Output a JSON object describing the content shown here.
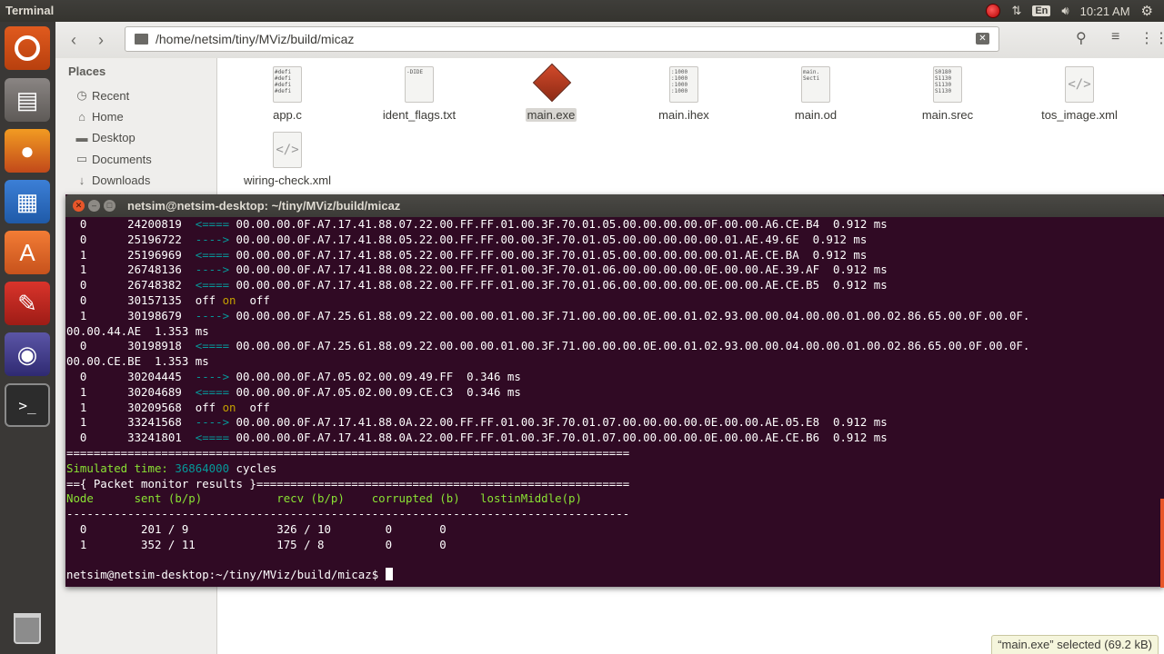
{
  "top_panel": {
    "app_title": "Terminal",
    "keyboard_layout": "En",
    "clock": "10:21 AM"
  },
  "toolbar": {
    "back": "‹",
    "forward": "›",
    "path": "/home/netsim/tiny/MViz/build/micaz"
  },
  "sidebar": {
    "heading": "Places",
    "items": [
      {
        "label": "Recent",
        "icon": "clock-icon"
      },
      {
        "label": "Home",
        "icon": "home-icon"
      },
      {
        "label": "Desktop",
        "icon": "desktop-folder-icon"
      },
      {
        "label": "Documents",
        "icon": "documents-icon"
      },
      {
        "label": "Downloads",
        "icon": "downloads-icon"
      }
    ]
  },
  "files": [
    {
      "name": "app.c",
      "preview": "#defi\n#defi\n#defi\n#defi"
    },
    {
      "name": "ident_flags.txt",
      "preview": "-DIDE"
    },
    {
      "name": "main.exe",
      "preview": ""
    },
    {
      "name": "main.ihex",
      "preview": ":1000\n:1000\n:1000\n:1000"
    },
    {
      "name": "main.od",
      "preview": "main.\n\nSecti"
    },
    {
      "name": "main.srec",
      "preview": "S0180\nS1130\nS1130\nS1130"
    },
    {
      "name": "tos_image.xml",
      "preview": "</>"
    },
    {
      "name": "wiring-check.xml",
      "preview": "</>"
    }
  ],
  "terminal": {
    "title": "netsim@netsim-desktop: ~/tiny/MViz/build/micaz",
    "rows": [
      {
        "node": "0",
        "time": "24200819",
        "dir": "<====",
        "packet": "00.00.00.0F.A7.17.41.88.07.22.00.FF.FF.01.00.3F.70.01.05.00.00.00.00.0F.00.00.A6.CE.B4",
        "dur": "0.912 ms"
      },
      {
        "node": "0",
        "time": "25196722",
        "dir": "---->",
        "packet": "00.00.00.0F.A7.17.41.88.05.22.00.FF.FF.00.00.3F.70.01.05.00.00.00.00.00.01.AE.49.6E",
        "dur": "0.912 ms"
      },
      {
        "node": "1",
        "time": "25196969",
        "dir": "<====",
        "packet": "00.00.00.0F.A7.17.41.88.05.22.00.FF.FF.00.00.3F.70.01.05.00.00.00.00.00.01.AE.CE.BA",
        "dur": "0.912 ms"
      },
      {
        "node": "1",
        "time": "26748136",
        "dir": "---->",
        "packet": "00.00.00.0F.A7.17.41.88.08.22.00.FF.FF.01.00.3F.70.01.06.00.00.00.00.0E.00.00.AE.39.AF",
        "dur": "0.912 ms"
      },
      {
        "node": "0",
        "time": "26748382",
        "dir": "<====",
        "packet": "00.00.00.0F.A7.17.41.88.08.22.00.FF.FF.01.00.3F.70.01.06.00.00.00.00.0E.00.00.AE.CE.B5",
        "dur": "0.912 ms"
      }
    ],
    "radio1": {
      "node": "0",
      "time": "30157135",
      "a": "off",
      "b": "on",
      "c": "off"
    },
    "long_rows": [
      {
        "node": "1",
        "time": "30198679",
        "dir": "---->",
        "packet": "00.00.00.0F.A7.25.61.88.09.22.00.00.00.01.00.3F.71.00.00.00.0E.00.01.02.93.00.00.04.00.00.01.00.02.86.65.00.0F.00.0F.",
        "wrap": "00.00.44.AE",
        "dur": "1.353 ms"
      },
      {
        "node": "0",
        "time": "30198918",
        "dir": "<====",
        "packet": "00.00.00.0F.A7.25.61.88.09.22.00.00.00.01.00.3F.71.00.00.00.0E.00.01.02.93.00.00.04.00.00.01.00.02.86.65.00.0F.00.0F.",
        "wrap": "00.00.CE.BE",
        "dur": "1.353 ms"
      }
    ],
    "rows2": [
      {
        "node": "0",
        "time": "30204445",
        "dir": "---->",
        "packet": "00.00.00.0F.A7.05.02.00.09.49.FF",
        "dur": "0.346 ms"
      },
      {
        "node": "1",
        "time": "30204689",
        "dir": "<====",
        "packet": "00.00.00.0F.A7.05.02.00.09.CE.C3",
        "dur": "0.346 ms"
      }
    ],
    "radio2": {
      "node": "1",
      "time": "30209568",
      "a": "off",
      "b": "on",
      "c": "off"
    },
    "rows3": [
      {
        "node": "1",
        "time": "33241568",
        "dir": "---->",
        "packet": "00.00.00.0F.A7.17.41.88.0A.22.00.FF.FF.01.00.3F.70.01.07.00.00.00.00.0E.00.00.AE.05.E8",
        "dur": "0.912 ms"
      },
      {
        "node": "0",
        "time": "33241801",
        "dir": "<====",
        "packet": "00.00.00.0F.A7.17.41.88.0A.22.00.FF.FF.01.00.3F.70.01.07.00.00.00.00.0E.00.00.AE.CE.B6",
        "dur": "0.912 ms"
      }
    ],
    "separator": "===================================================================================",
    "sim_label": "Simulated time:",
    "sim_value": "36864000",
    "sim_unit": "cycles",
    "pm_header": "=={ Packet monitor results }=======================================================",
    "table_headers": {
      "node": "Node",
      "sent": "sent (b/p)",
      "recv": "recv (b/p)",
      "corrupted": "corrupted (b)",
      "lost": "lostinMiddle(p)"
    },
    "dash_line": "-----------------------------------------------------------------------------------",
    "table_rows": [
      {
        "node": "0",
        "sent": "201 / 9",
        "recv": "326 / 10",
        "corrupted": "0",
        "lost": "0"
      },
      {
        "node": "1",
        "sent": "352 / 11",
        "recv": "175 / 8",
        "corrupted": "0",
        "lost": "0"
      }
    ],
    "prompt": "netsim@netsim-desktop:~/tiny/MViz/build/micaz$ "
  },
  "status_bar": "“main.exe” selected (69.2 kB)"
}
